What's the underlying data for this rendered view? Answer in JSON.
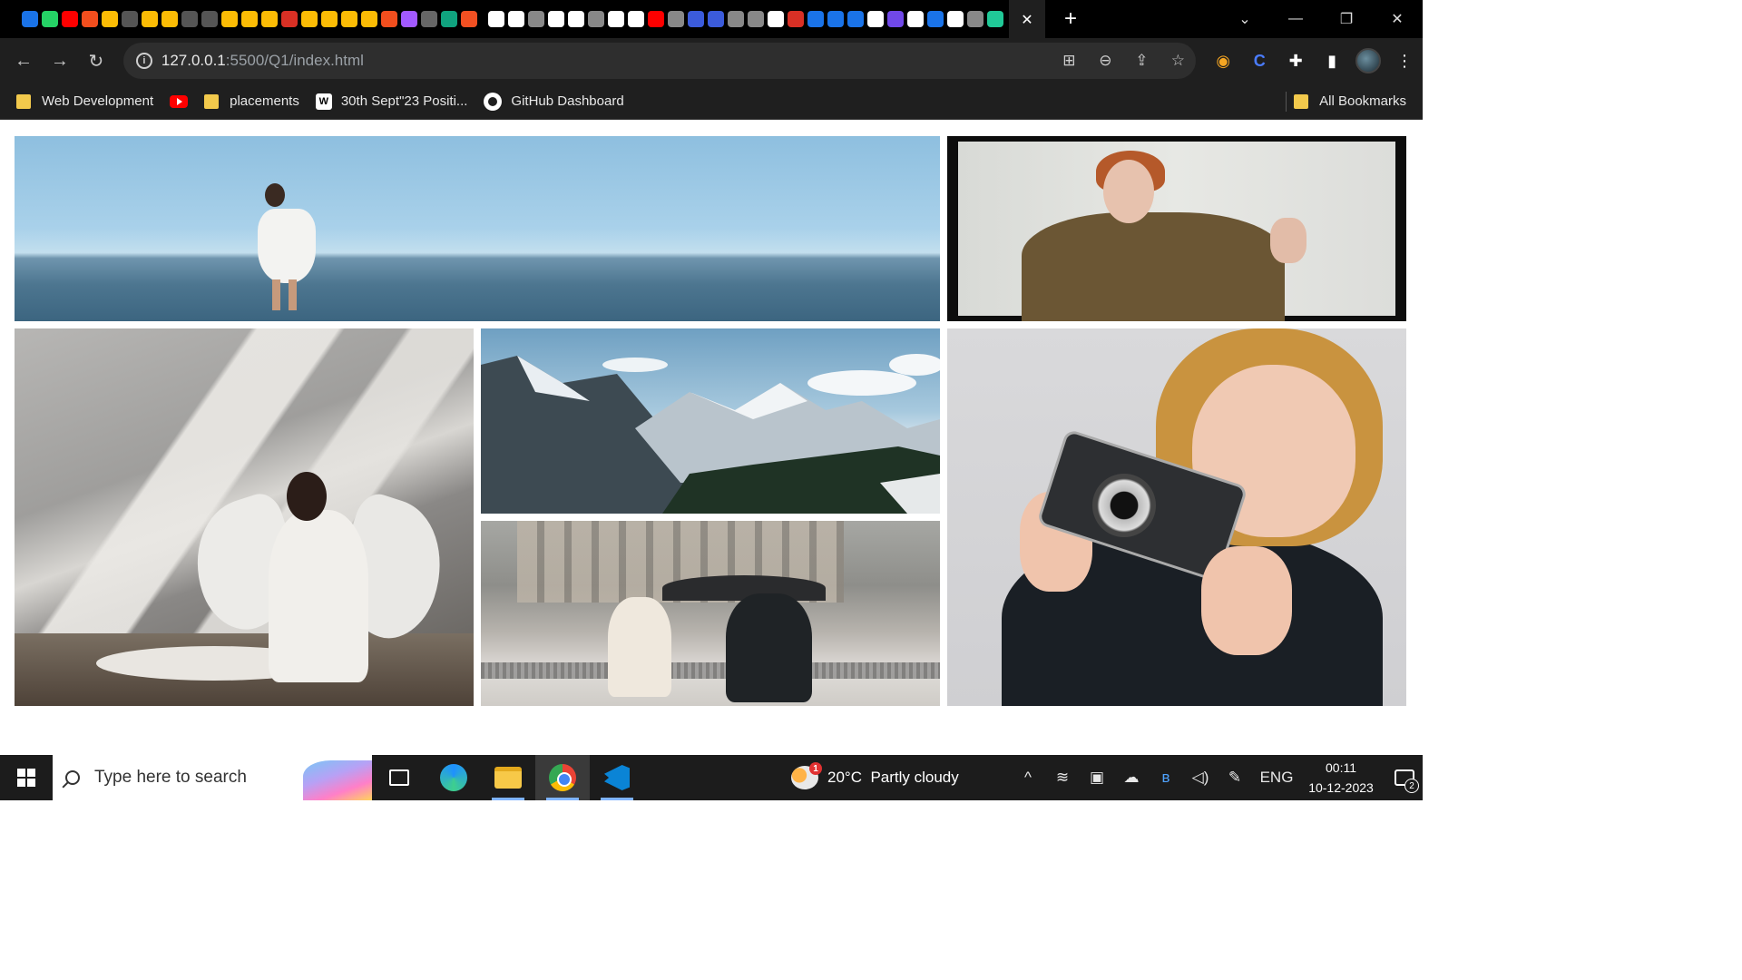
{
  "browser": {
    "tab_close_glyph": "✕",
    "new_tab_glyph": "+",
    "favicon_colors": [
      "#1a73e8",
      "#25d366",
      "#ff0000",
      "#f24e1e",
      "#fbbc05",
      "#555555",
      "#fbbc05",
      "#fbbc05",
      "#555555",
      "#555555",
      "#fbbc05",
      "#fbbc05",
      "#fbbc05",
      "#d93025",
      "#fbbc05",
      "#fbbc05",
      "#fbbc05",
      "#fbbc05",
      "#f24e1e",
      "#a259ff",
      "#666666",
      "#10a37f",
      "#f25022"
    ],
    "favicon_colors_2": [
      "#ffffff",
      "#ffffff",
      "#888888",
      "#ffffff",
      "#ffffff",
      "#888888",
      "#ffffff",
      "#ffffff",
      "#ff0000",
      "#888888",
      "#3b5bdb",
      "#3b5bdb",
      "#888888",
      "#888888",
      "#ffffff",
      "#d93025",
      "#1a73e8",
      "#1a73e8",
      "#1a73e8",
      "#ffffff",
      "#7048e8",
      "#ffffff",
      "#1a73e8",
      "#ffffff",
      "#888888",
      "#20c997"
    ],
    "window_controls": {
      "minimize": "—",
      "restore": "❐",
      "close": "✕",
      "tab_search": "⌄"
    }
  },
  "toolbar": {
    "back_glyph": "←",
    "forward_glyph": "→",
    "reload_glyph": "↻",
    "url_host": "127.0.0.1",
    "url_rest": ":5500/Q1/index.html",
    "info_glyph": "i",
    "actions": {
      "translate": "⊞",
      "zoom": "⊖",
      "share": "⇪",
      "star": "☆"
    },
    "extensions": {
      "shield": "◉",
      "c": "C",
      "puzzle": "✚",
      "sidepanel": "▮",
      "menu": "⋮"
    }
  },
  "bookmarks": {
    "items": [
      {
        "label": "Web Development",
        "icon": "folder-icon"
      },
      {
        "label": "",
        "icon": "youtube-icon"
      },
      {
        "label": "placements",
        "icon": "folder-icon"
      },
      {
        "label": "30th Sept\"23 Positi...",
        "icon": "site-icon"
      },
      {
        "label": "GitHub Dashboard",
        "icon": "github-icon"
      }
    ],
    "all_bookmarks": "All Bookmarks",
    "site_icon_glyph": "W"
  },
  "gallery": {
    "images": [
      {
        "subject": "woman-beach-photo"
      },
      {
        "subject": "woman-coat-photo"
      },
      {
        "subject": "angel-wings-photo"
      },
      {
        "subject": "mountains-photo"
      },
      {
        "subject": "camera-girl-photo"
      },
      {
        "subject": "couple-snow-photo"
      }
    ]
  },
  "taskbar": {
    "search_placeholder": "Type here to search",
    "weather_temp": "20°C",
    "weather_desc": "Partly cloudy",
    "weather_badge": "1",
    "language": "ENG",
    "time": "00:11",
    "date": "10-12-2023",
    "notification_count": "2",
    "tray": {
      "chevron": "^",
      "wifi": "≋",
      "meet": "▣",
      "cloud": "☁",
      "bluetooth": "ʙ",
      "volume": "◁)",
      "pen": "✎"
    }
  }
}
